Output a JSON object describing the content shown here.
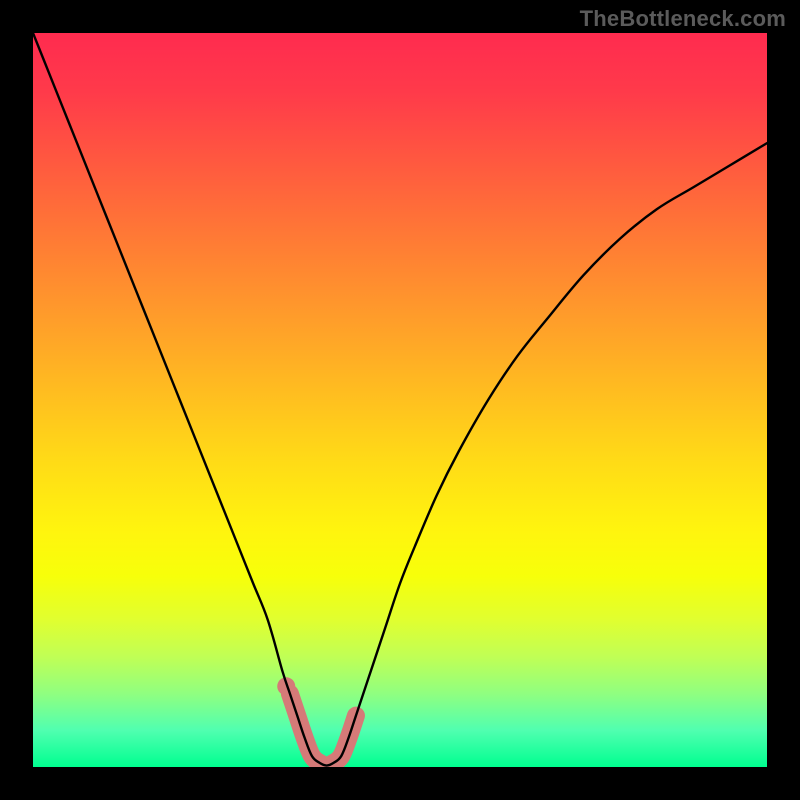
{
  "watermark": "TheBottleneck.com",
  "colors": {
    "frame": "#000000",
    "curve": "#000000",
    "highlight": "#d57a78",
    "gradient_top": "#ff2b4f",
    "gradient_bottom": "#00ff90"
  },
  "chart_data": {
    "type": "line",
    "title": "",
    "xlabel": "",
    "ylabel": "",
    "xlim": [
      0,
      100
    ],
    "ylim": [
      0,
      100
    ],
    "x": [
      0,
      2,
      4,
      6,
      8,
      10,
      12,
      14,
      16,
      18,
      20,
      22,
      24,
      26,
      28,
      30,
      32,
      34,
      35,
      36,
      37,
      38,
      39,
      40,
      41,
      42,
      43,
      44,
      46,
      48,
      50,
      52,
      55,
      58,
      62,
      66,
      70,
      75,
      80,
      85,
      90,
      95,
      100
    ],
    "series": [
      {
        "name": "bottleneck-curve",
        "x": [
          0,
          2,
          4,
          6,
          8,
          10,
          12,
          14,
          16,
          18,
          20,
          22,
          24,
          26,
          28,
          30,
          32,
          34,
          35,
          36,
          37,
          38,
          39,
          40,
          41,
          42,
          43,
          44,
          46,
          48,
          50,
          52,
          55,
          58,
          62,
          66,
          70,
          75,
          80,
          85,
          90,
          95,
          100
        ],
        "values": [
          100,
          95,
          90,
          85,
          80,
          75,
          70,
          65,
          60,
          55,
          50,
          45,
          40,
          35,
          30,
          25,
          20,
          13,
          10,
          7,
          4,
          1.5,
          0.6,
          0.2,
          0.6,
          1.5,
          4,
          7,
          13,
          19,
          25,
          30,
          37,
          43,
          50,
          56,
          61,
          67,
          72,
          76,
          79,
          82,
          85
        ]
      }
    ],
    "highlight_region": {
      "x": [
        35,
        36,
        37,
        38,
        39,
        40,
        41,
        42,
        43,
        44
      ],
      "values": [
        10,
        7,
        4,
        1.5,
        0.6,
        0.2,
        0.6,
        1.5,
        4,
        7
      ]
    },
    "highlight_dot": {
      "x": 34.5,
      "y": 11
    },
    "annotations": []
  }
}
